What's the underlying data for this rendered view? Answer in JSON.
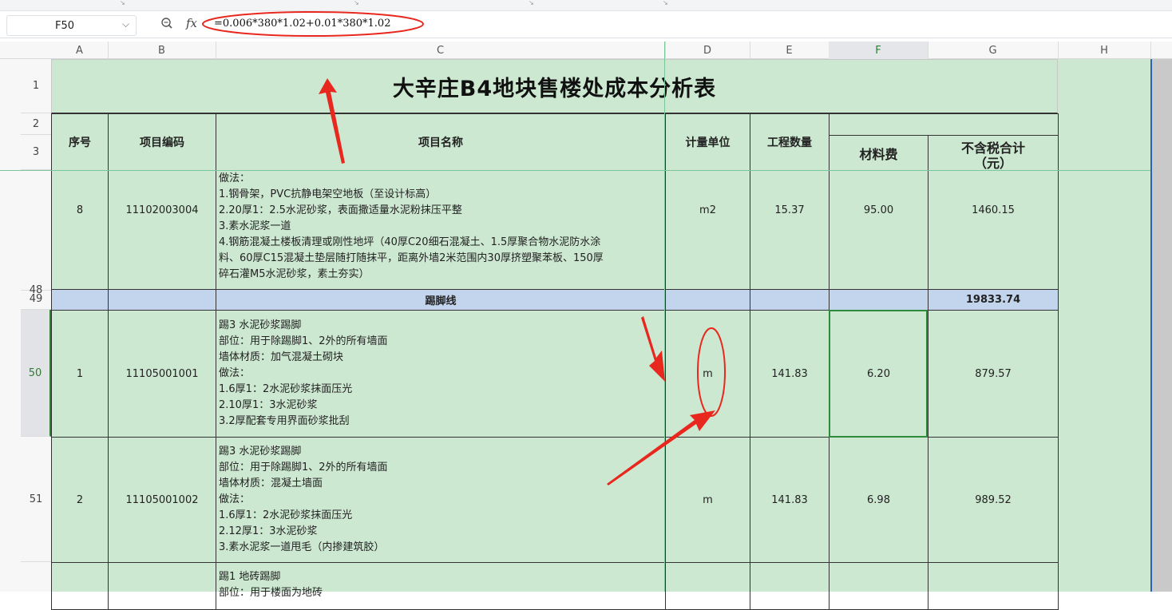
{
  "name_box": "F50",
  "formula": "=0.006*380*1.02+0.01*380*1.02",
  "icons": {
    "zoom": "zoom-icon",
    "fx": "fx-icon",
    "chevron": "chevron-down-icon"
  },
  "fx_label": "fx",
  "outline_levels": "1 2",
  "select_all_glyph": "◢",
  "columns": [
    "A",
    "B",
    "C",
    "D",
    "E",
    "F",
    "G",
    "H"
  ],
  "rows": [
    "1",
    "2",
    "3",
    "48",
    "49",
    "50",
    "51"
  ],
  "sheet": {
    "title": "大辛庄B4地块售楼处成本分析表",
    "headers": {
      "seq": "序号",
      "code": "项目编码",
      "name": "项目名称",
      "unit": "计量单位",
      "qty": "工程数量",
      "material": "材料费",
      "total": "不含税合计\n（元）"
    },
    "row48": {
      "seq": "8",
      "code": "11102003004",
      "desc": "做法：\n1.钢骨架，PVC抗静电架空地板（至设计标高）\n2.20厚1：2.5水泥砂浆，表面撒适量水泥粉抹压平整\n3.素水泥浆一道\n4.钢筋混凝土楼板清理或刚性地坪（40厚C20细石混凝土、1.5厚聚合物水泥防水涂\n料、60厚C15混凝土垫层随打随抹平，距离外墙2米范围内30厚挤塑聚苯板、150厚\n碎石灌M5水泥砂浆，素土夯实）",
      "unit": "m2",
      "qty": "15.37",
      "material": "95.00",
      "total": "1460.15"
    },
    "row49": {
      "name": "踢脚线",
      "total": "19833.74"
    },
    "row50": {
      "seq": "1",
      "code": "11105001001",
      "desc": "踢3 水泥砂浆踢脚\n部位：用于除踢脚1、2外的所有墙面\n墙体材质：加气混凝土砌块\n做法：\n1.6厚1：2水泥砂浆抹面压光\n2.10厚1：3水泥砂浆\n3.2厚配套专用界面砂浆批刮",
      "unit": "m",
      "qty": "141.83",
      "material": "6.20",
      "total": "879.57"
    },
    "row51": {
      "seq": "2",
      "code": "11105001002",
      "desc": "踢3 水泥砂浆踢脚\n部位：用于除踢脚1、2外的所有墙面\n墙体材质：混凝土墙面\n做法：\n1.6厚1：2水泥砂浆抹面压光\n2.12厚1：3水泥砂浆\n3.素水泥浆一道甩毛（内掺建筑胶）",
      "unit": "m",
      "qty": "141.83",
      "material": "6.98",
      "total": "989.52"
    },
    "row52": {
      "desc": "踢1 地砖踢脚\n部位：用于楼面为地砖"
    }
  },
  "colors": {
    "sheet_bg": "#cde8d1",
    "section_row": "#c3d5ed",
    "annotation_red": "#e8281e",
    "selection_green": "#2e8b3a"
  }
}
